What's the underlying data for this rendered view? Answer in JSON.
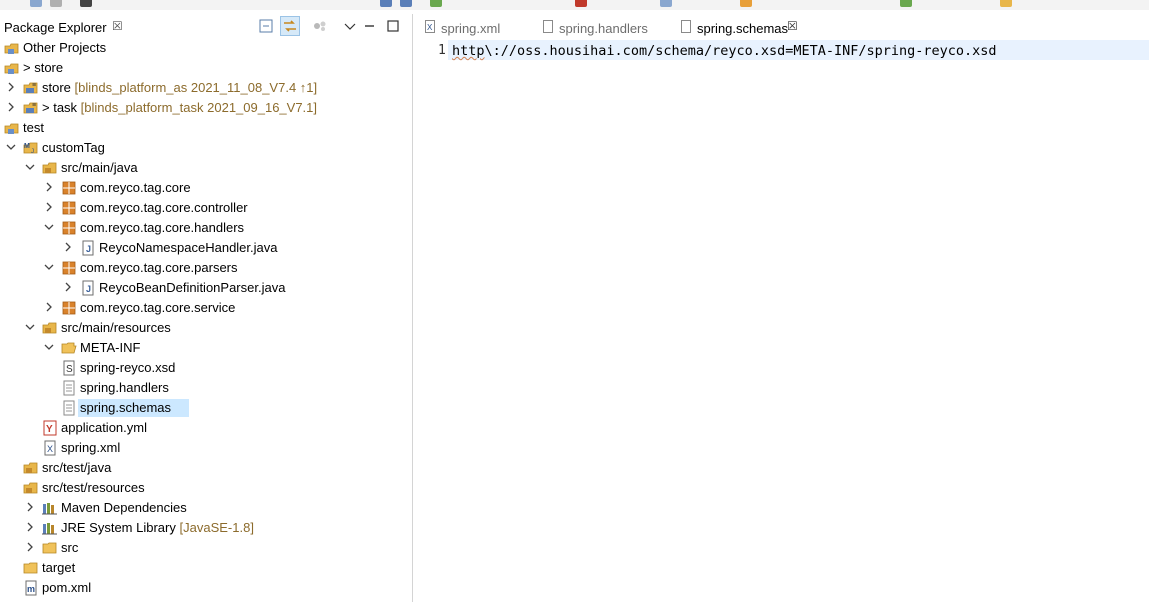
{
  "explorer": {
    "title": "Package Explorer",
    "close_glyph": "☒",
    "tree": [
      {
        "label": "Other Projects",
        "deco": "",
        "icon": "working-set-icon",
        "expander": "none"
      },
      {
        "label": "> store",
        "deco": "",
        "icon": "working-set-icon",
        "expander": "none"
      },
      {
        "label": "store",
        "deco": "[blinds_platform_as 2021_11_08_V7.4 ↑1]",
        "icon": "project-icon",
        "expander": "collapsed"
      },
      {
        "label": "> task",
        "deco": "[blinds_platform_task 2021_09_16_V7.1]",
        "icon": "project-icon",
        "expander": "collapsed"
      },
      {
        "label": "test",
        "deco": "",
        "icon": "working-set-icon",
        "expander": "none"
      },
      {
        "label": "customTag",
        "deco": "",
        "icon": "maven-project-icon",
        "expander": "expanded"
      },
      {
        "label": "src/main/java",
        "deco": "",
        "icon": "source-folder-icon",
        "expander": "expanded"
      },
      {
        "label": "com.reyco.tag.core",
        "deco": "",
        "icon": "package-icon",
        "expander": "collapsed"
      },
      {
        "label": "com.reyco.tag.core.controller",
        "deco": "",
        "icon": "package-icon",
        "expander": "collapsed"
      },
      {
        "label": "com.reyco.tag.core.handlers",
        "deco": "",
        "icon": "package-icon",
        "expander": "expanded"
      },
      {
        "label": "ReycoNamespaceHandler.java",
        "deco": "",
        "icon": "java-file-icon",
        "expander": "collapsed"
      },
      {
        "label": "com.reyco.tag.core.parsers",
        "deco": "",
        "icon": "package-icon",
        "expander": "expanded"
      },
      {
        "label": "ReycoBeanDefinitionParser.java",
        "deco": "",
        "icon": "java-file-icon",
        "expander": "collapsed"
      },
      {
        "label": "com.reyco.tag.core.service",
        "deco": "",
        "icon": "package-icon",
        "expander": "collapsed"
      },
      {
        "label": "src/main/resources",
        "deco": "",
        "icon": "source-folder-icon",
        "expander": "expanded"
      },
      {
        "label": "META-INF",
        "deco": "",
        "icon": "folder-open-icon",
        "expander": "expanded"
      },
      {
        "label": "spring-reyco.xsd",
        "deco": "",
        "icon": "xsd-file-icon",
        "expander": "none"
      },
      {
        "label": "spring.handlers",
        "deco": "",
        "icon": "text-file-icon",
        "expander": "none"
      },
      {
        "label": "spring.schemas",
        "deco": "",
        "icon": "text-file-icon",
        "expander": "none",
        "selected": true
      },
      {
        "label": "application.yml",
        "deco": "",
        "icon": "yaml-file-icon",
        "expander": "none"
      },
      {
        "label": "spring.xml",
        "deco": "",
        "icon": "xml-file-icon",
        "expander": "none"
      },
      {
        "label": "src/test/java",
        "deco": "",
        "icon": "source-folder-icon",
        "expander": "none"
      },
      {
        "label": "src/test/resources",
        "deco": "",
        "icon": "source-folder-icon",
        "expander": "none"
      },
      {
        "label": "Maven Dependencies",
        "deco": "",
        "icon": "library-icon",
        "expander": "collapsed"
      },
      {
        "label": "JRE System Library",
        "deco": "[JavaSE-1.8]",
        "icon": "library-icon",
        "expander": "collapsed"
      },
      {
        "label": "src",
        "deco": "",
        "icon": "folder-icon",
        "expander": "collapsed"
      },
      {
        "label": "target",
        "deco": "",
        "icon": "folder-icon",
        "expander": "none"
      },
      {
        "label": "pom.xml",
        "deco": "",
        "icon": "maven-pom-icon",
        "expander": "none"
      }
    ]
  },
  "editor": {
    "tabs": [
      {
        "label": "spring.xml",
        "icon": "xml-file-icon",
        "active": false
      },
      {
        "label": "spring.handlers",
        "icon": "text-file-icon",
        "active": false
      },
      {
        "label": "spring.schemas",
        "icon": "text-file-icon",
        "active": true
      }
    ],
    "close_glyph": "☒",
    "lines": [
      {
        "number": "1",
        "squiggle": "http",
        "rest": "\\://oss.housihai.com/schema/reyco.xsd=META-INF/spring-reyco.xsd"
      }
    ]
  }
}
